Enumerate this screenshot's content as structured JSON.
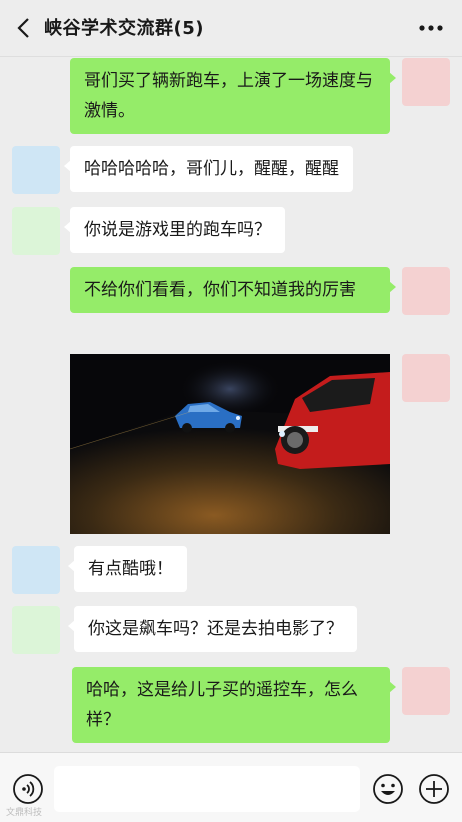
{
  "header": {
    "title": "峡谷学术交流群(5)",
    "back_icon": "chevron-left-icon",
    "more_icon": "more-dots-icon"
  },
  "messages": [
    {
      "sender": "me",
      "text": "哥们买了辆新跑车，上演了一场速度与激情。"
    },
    {
      "sender": "member-blue",
      "text": "哈哈哈哈哈，哥们儿，醒醒，醒醒"
    },
    {
      "sender": "member-green",
      "text": "你说是游戏里的跑车吗？"
    },
    {
      "sender": "me",
      "text": "不给你们看看，你们不知道我的厉害"
    },
    {
      "sender": "me",
      "type": "image",
      "description_icon": "photo-racing-cars"
    },
    {
      "sender": "member-blue",
      "text": "有点酷哦！"
    },
    {
      "sender": "member-green",
      "text": "你这是飙车吗？还是去拍电影了？"
    },
    {
      "sender": "me",
      "text": "哈哈，这是给儿子买的遥控车，怎么样？"
    }
  ],
  "input_bar": {
    "voice_icon": "voice-icon",
    "emoji_icon": "emoji-icon",
    "plus_icon": "plus-icon",
    "input_value": ""
  },
  "colors": {
    "background": "#ededed",
    "outgoing_bubble": "#95ec69",
    "incoming_bubble": "#ffffff"
  },
  "watermark": "文鼎科技"
}
